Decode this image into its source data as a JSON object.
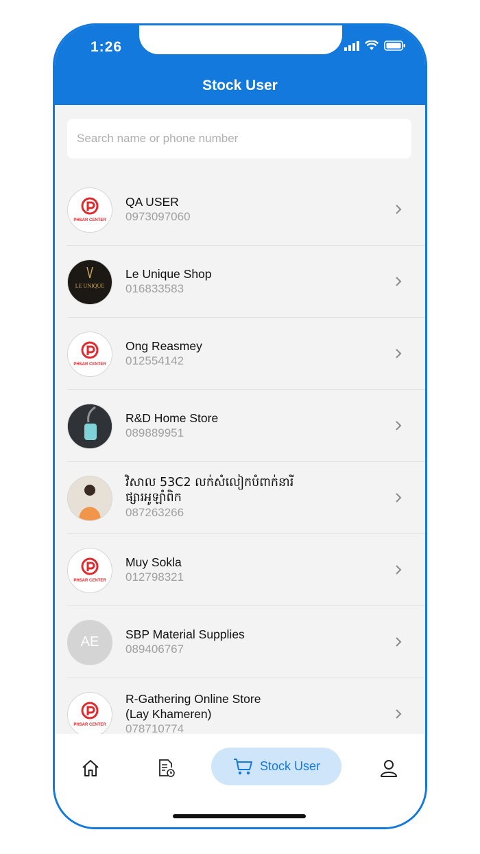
{
  "status_bar": {
    "time": "1:26"
  },
  "header": {
    "title": "Stock User"
  },
  "search": {
    "placeholder": "Search name or phone number"
  },
  "users": [
    {
      "name": "QA USER",
      "phone": "0973097060",
      "avatar": "phsar-center-logo"
    },
    {
      "name": "Le Unique Shop",
      "phone": "016833583",
      "avatar": "le-unique-logo"
    },
    {
      "name": "Ong Reasmey",
      "phone": "012554142",
      "avatar": "phsar-center-logo"
    },
    {
      "name": "R&D Home Store",
      "phone": "089889951",
      "avatar": "product-photo"
    },
    {
      "name": "វិសាល 53C2 លក់សំលៀកបំពាក់នារី ផ្សារអូឡាំពិក",
      "phone": "087263266",
      "avatar": "person-photo"
    },
    {
      "name": "Muy Sokla",
      "phone": "012798321",
      "avatar": "phsar-center-logo"
    },
    {
      "name": "SBP Material Supplies",
      "phone": "089406767",
      "avatar": "ae-logo"
    },
    {
      "name": "R-Gathering Online Store (Lay Khameren)",
      "phone": "078710774",
      "avatar": "phsar-center-logo"
    }
  ],
  "logos": {
    "phsar_center_text": "PHSAR CENTER",
    "le_unique_text": "LE UNIQUE",
    "ae_text": "AE"
  },
  "bottom_nav": {
    "items": [
      {
        "icon": "home-icon"
      },
      {
        "icon": "report-icon"
      },
      {
        "icon": "cart-icon",
        "label": "Stock User",
        "active": true
      },
      {
        "icon": "profile-icon"
      }
    ]
  },
  "colors": {
    "accent": "#1479dc",
    "pill": "#cfe5f9",
    "background": "#f3f3f3"
  }
}
